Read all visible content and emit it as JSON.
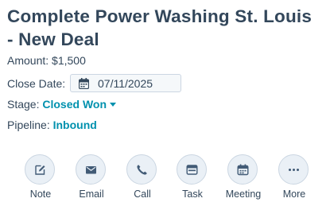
{
  "deal": {
    "title": "Complete Power Washing St. Louis - New Deal",
    "amount_label": "Amount:",
    "amount_value": "$1,500",
    "close_date_label": "Close Date:",
    "close_date_value": "07/11/2025",
    "stage_label": "Stage:",
    "stage_value": "Closed Won",
    "pipeline_label": "Pipeline:",
    "pipeline_value": "Inbound"
  },
  "actions": [
    {
      "label": "Note",
      "icon": "edit-icon"
    },
    {
      "label": "Email",
      "icon": "email-icon"
    },
    {
      "label": "Call",
      "icon": "phone-icon"
    },
    {
      "label": "Task",
      "icon": "task-icon"
    },
    {
      "label": "Meeting",
      "icon": "calendar-icon"
    },
    {
      "label": "More",
      "icon": "more-icon"
    }
  ],
  "colors": {
    "text": "#33475b",
    "link": "#0091ae",
    "button_bg": "#eaf0f6",
    "button_border": "#cbd6e2",
    "icon": "#425b76"
  }
}
